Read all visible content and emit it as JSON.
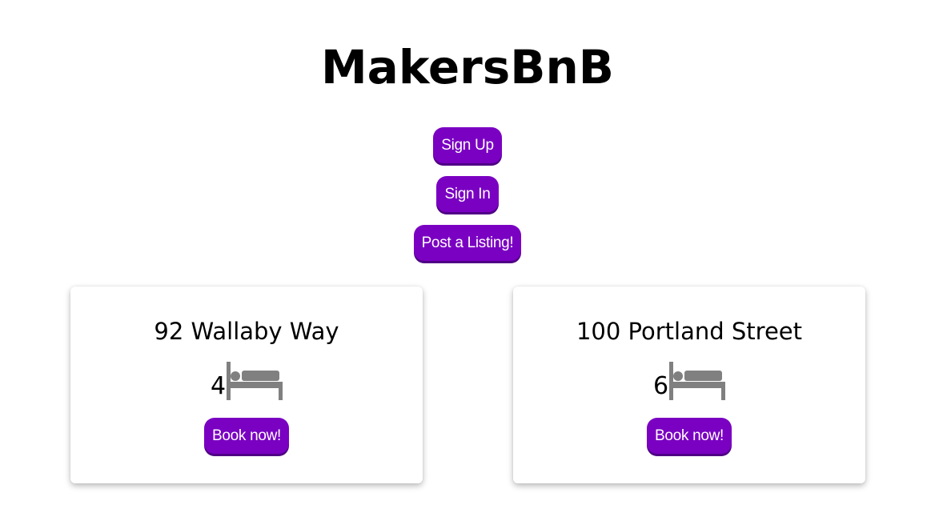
{
  "header": {
    "title": "MakersBnB"
  },
  "nav": {
    "sign_up_label": "Sign Up",
    "sign_in_label": "Sign In",
    "post_listing_label": "Post a Listing!"
  },
  "listings": [
    {
      "address": "92 Wallaby Way",
      "beds": "4",
      "bed_icon": "bed-icon",
      "book_label": "Book now!"
    },
    {
      "address": "100 Portland Street",
      "beds": "6",
      "bed_icon": "bed-icon",
      "book_label": "Book now!"
    }
  ],
  "colors": {
    "button_background": "#7a00c2",
    "button_text": "#ffffff",
    "bed_icon": "#808080"
  }
}
